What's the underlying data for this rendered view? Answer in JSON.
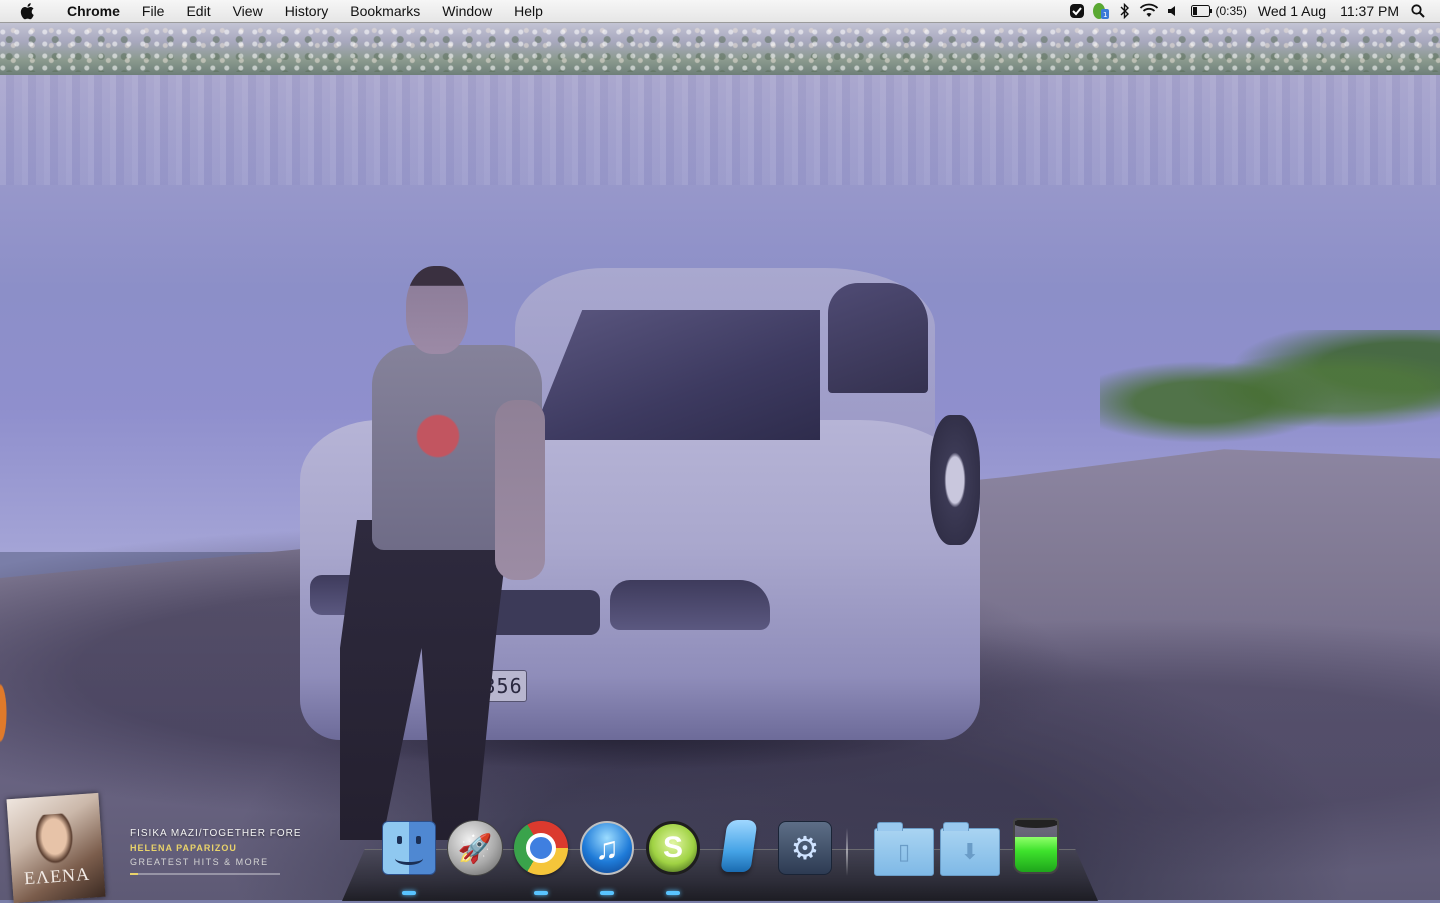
{
  "menubar": {
    "app_name": "Chrome",
    "menus": [
      "File",
      "Edit",
      "View",
      "History",
      "Bookmarks",
      "Window",
      "Help"
    ],
    "status": {
      "battery_time": "(0:35)",
      "date": "Wed 1 Aug",
      "time": "11:37 PM",
      "icons": [
        "checkmark-shield-icon",
        "evernote-sync-icon",
        "bluetooth-icon",
        "wifi-icon",
        "volume-icon",
        "battery-icon",
        "spotlight-search-icon"
      ]
    }
  },
  "now_playing": {
    "song": "FISIKA MAZI/TOGETHER FOREVER",
    "artist": "HELENA PAPARIZOU",
    "album": "GREATEST HITS & MORE",
    "album_art_title": "EΛENA",
    "progress": 0.05
  },
  "wallpaper": {
    "license_plate": "K 1356"
  },
  "dock": {
    "items": [
      {
        "name": "Finder",
        "icon": "finder-icon",
        "running": true
      },
      {
        "name": "Launchpad",
        "icon": "launchpad-rocket-icon",
        "running": false
      },
      {
        "name": "Google Chrome",
        "icon": "chrome-icon",
        "running": true
      },
      {
        "name": "iTunes",
        "icon": "itunes-icon",
        "running": true
      },
      {
        "name": "Skype",
        "icon": "skype-icon",
        "running": true
      },
      {
        "name": "Eraser",
        "icon": "eraser-icon",
        "running": false
      },
      {
        "name": "System Preferences",
        "icon": "system-preferences-icon",
        "running": false
      },
      {
        "name": "Documents",
        "icon": "documents-folder-icon",
        "running": false
      },
      {
        "name": "Downloads",
        "icon": "downloads-folder-icon",
        "running": false
      },
      {
        "name": "Trash",
        "icon": "trash-icon",
        "running": false
      }
    ]
  }
}
